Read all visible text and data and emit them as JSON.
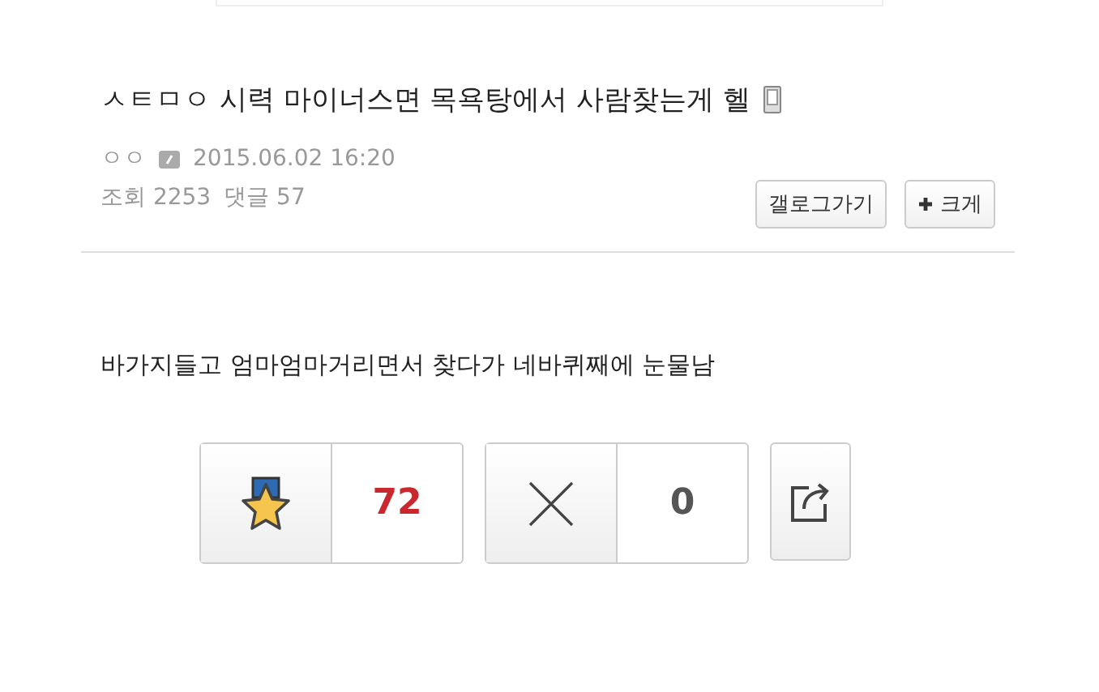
{
  "post": {
    "title": "ㅅㅌㅁㅇ 시력 마이너스면 목욕탕에서 사람찾는게 헬",
    "author": "ㅇㅇ",
    "date": "2015.06.02 16:20",
    "views_label": "조회",
    "views": "2253",
    "comments_label": "댓글",
    "comments": "57"
  },
  "buttons": [
    {
      "label": "갤로그가기",
      "kind": "text"
    },
    {
      "label": "크게",
      "kind": "plus"
    }
  ],
  "body": "바가지들고 엄마엄마거리면서 찾다가 네바퀴째에 눈물남",
  "votes": [
    {
      "kind": "recommend",
      "count": "72"
    },
    {
      "kind": "dislike",
      "count": "0"
    }
  ]
}
